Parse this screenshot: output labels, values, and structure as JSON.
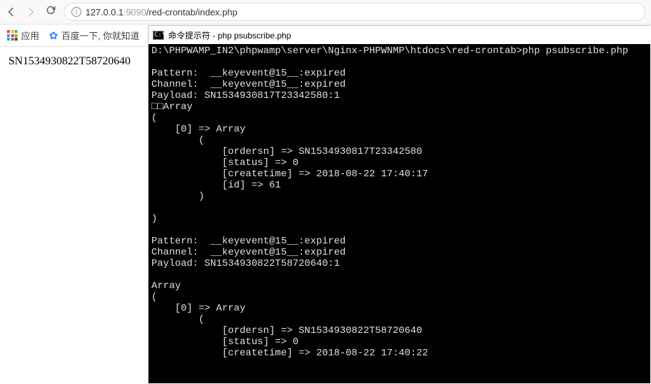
{
  "browser": {
    "url_host": "127.0.0.1",
    "url_port": ":9090",
    "url_path": "/red-crontab/index.php"
  },
  "bookmarks": {
    "apps_label": "应用",
    "baidu_label": "百度一下, 你就知道"
  },
  "page_text": "SN1534930822T58720640",
  "terminal": {
    "title": "命令提示符 - php  psubscribe.php",
    "lines": [
      "D:\\PHPWAMP_IN2\\phpwamp\\server\\Nginx-PHPWNMP\\htdocs\\red-crontab>php psubscribe.php",
      "",
      "Pattern:  __keyevent@15__:expired",
      "Channel:  __keyevent@15__:expired",
      "Payload: SN1534930817T23342580:1",
      "□□Array",
      "(",
      "    [0] => Array",
      "        (",
      "            [ordersn] => SN1534930817T23342580",
      "            [status] => 0",
      "            [createtime] => 2018-08-22 17:40:17",
      "            [id] => 61",
      "        )",
      "",
      ")",
      "",
      "Pattern:  __keyevent@15__:expired",
      "Channel:  __keyevent@15__:expired",
      "Payload: SN1534930822T58720640:1",
      "",
      "Array",
      "(",
      "    [0] => Array",
      "        (",
      "            [ordersn] => SN1534930822T58720640",
      "            [status] => 0",
      "            [createtime] => 2018-08-22 17:40:22"
    ]
  }
}
